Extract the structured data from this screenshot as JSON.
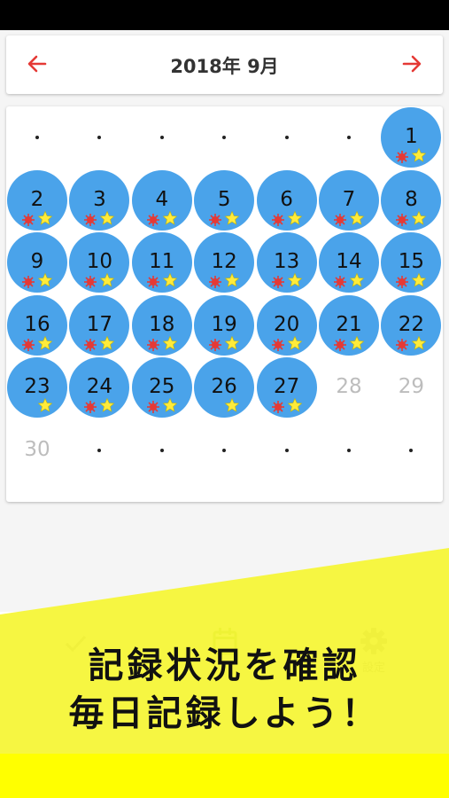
{
  "header": {
    "title": "2018年 9月",
    "prev_icon": "arrow-left-icon",
    "next_icon": "arrow-right-icon",
    "arrow_color": "#e53935"
  },
  "calendar": {
    "circle_color": "#4aa3ea",
    "days": [
      {
        "label": ".",
        "type": "dot"
      },
      {
        "label": ".",
        "type": "dot"
      },
      {
        "label": ".",
        "type": "dot"
      },
      {
        "label": ".",
        "type": "dot"
      },
      {
        "label": ".",
        "type": "dot"
      },
      {
        "label": ".",
        "type": "dot"
      },
      {
        "label": "1",
        "type": "recorded",
        "sun": true,
        "star": true
      },
      {
        "label": "2",
        "type": "recorded",
        "sun": true,
        "star": true
      },
      {
        "label": "3",
        "type": "recorded",
        "sun": true,
        "star": true
      },
      {
        "label": "4",
        "type": "recorded",
        "sun": true,
        "star": true
      },
      {
        "label": "5",
        "type": "recorded",
        "sun": true,
        "star": true
      },
      {
        "label": "6",
        "type": "recorded",
        "sun": true,
        "star": true
      },
      {
        "label": "7",
        "type": "recorded",
        "sun": true,
        "star": true
      },
      {
        "label": "8",
        "type": "recorded",
        "sun": true,
        "star": true
      },
      {
        "label": "9",
        "type": "recorded",
        "sun": true,
        "star": true
      },
      {
        "label": "10",
        "type": "recorded",
        "sun": true,
        "star": true
      },
      {
        "label": "11",
        "type": "recorded",
        "sun": true,
        "star": true
      },
      {
        "label": "12",
        "type": "recorded",
        "sun": true,
        "star": true
      },
      {
        "label": "13",
        "type": "recorded",
        "sun": true,
        "star": true
      },
      {
        "label": "14",
        "type": "recorded",
        "sun": true,
        "star": true
      },
      {
        "label": "15",
        "type": "recorded",
        "sun": true,
        "star": true
      },
      {
        "label": "16",
        "type": "recorded",
        "sun": true,
        "star": true
      },
      {
        "label": "17",
        "type": "recorded",
        "sun": true,
        "star": true
      },
      {
        "label": "18",
        "type": "recorded",
        "sun": true,
        "star": true
      },
      {
        "label": "19",
        "type": "recorded",
        "sun": true,
        "star": true
      },
      {
        "label": "20",
        "type": "recorded",
        "sun": true,
        "star": true
      },
      {
        "label": "21",
        "type": "recorded",
        "sun": true,
        "star": true
      },
      {
        "label": "22",
        "type": "recorded",
        "sun": true,
        "star": true
      },
      {
        "label": "23",
        "type": "recorded",
        "sun": false,
        "star": true
      },
      {
        "label": "24",
        "type": "recorded",
        "sun": true,
        "star": true
      },
      {
        "label": "25",
        "type": "recorded",
        "sun": true,
        "star": true
      },
      {
        "label": "26",
        "type": "recorded",
        "sun": false,
        "star": true
      },
      {
        "label": "27",
        "type": "recorded",
        "sun": true,
        "star": true
      },
      {
        "label": "28",
        "type": "future"
      },
      {
        "label": "29",
        "type": "future"
      },
      {
        "label": "30",
        "type": "future"
      },
      {
        "label": ".",
        "type": "dot"
      },
      {
        "label": ".",
        "type": "dot"
      },
      {
        "label": ".",
        "type": "dot"
      },
      {
        "label": ".",
        "type": "dot"
      },
      {
        "label": ".",
        "type": "dot"
      },
      {
        "label": ".",
        "type": "dot"
      }
    ]
  },
  "bottom_nav": {
    "items": [
      {
        "icon": "check-icon",
        "label": ""
      },
      {
        "icon": "calendar-icon",
        "label": ""
      },
      {
        "icon": "gear-icon",
        "label": "設定"
      }
    ],
    "active_color": "#8bc34a"
  },
  "banner": {
    "line1": "記録状況を確認",
    "line2": "毎日記録しよう！",
    "color": "#f5f534"
  }
}
